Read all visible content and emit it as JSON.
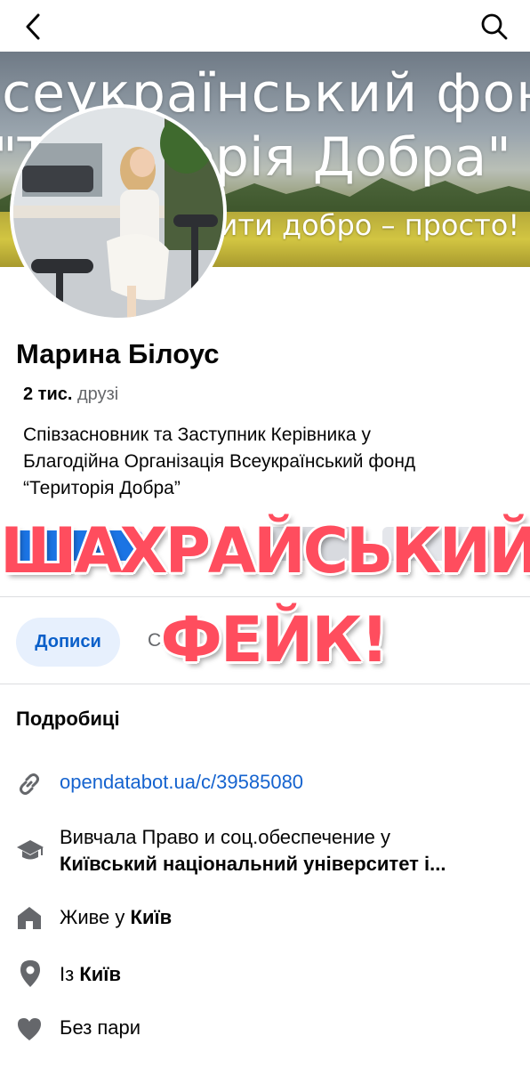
{
  "cover": {
    "line1": "Всеукраїнський фонд",
    "line2": "\"Територія Добра\"",
    "line3": "Робити добро – просто!"
  },
  "profile": {
    "name": "Марина Білоус",
    "friends_count": "2 тис.",
    "friends_label": "друзі",
    "bio_lines": [
      "Співзасновник та Заступник Керівника у",
      "Благодійна Організація Всеукраїнський фонд",
      "“Територія Добра”"
    ]
  },
  "overlay": {
    "line1": "ШАХРАЙСЬКИЙ",
    "line2": "ФЕЙК!"
  },
  "tabs": {
    "posts": "Дописи",
    "other": "Сі"
  },
  "details": {
    "title": "Подробиці",
    "link": "opendatabot.ua/c/39585080",
    "education_prefix": "Вивчала Право и соц.обеспечение  у",
    "education_school": "Київський національний університет і...",
    "lives_prefix": "Живе у ",
    "lives_city": "Київ",
    "from_prefix": "Із ",
    "from_city": "Київ",
    "relationship": "Без пари"
  },
  "icons": [
    "back-arrow-icon",
    "search-icon",
    "link-icon",
    "graduation-cap-icon",
    "home-icon",
    "location-pin-icon",
    "heart-icon"
  ],
  "colors": {
    "accent_blue": "#1563cf",
    "overlay_red": "#ff4d5e",
    "muted": "#65676b",
    "icon_gray": "#65676b"
  }
}
